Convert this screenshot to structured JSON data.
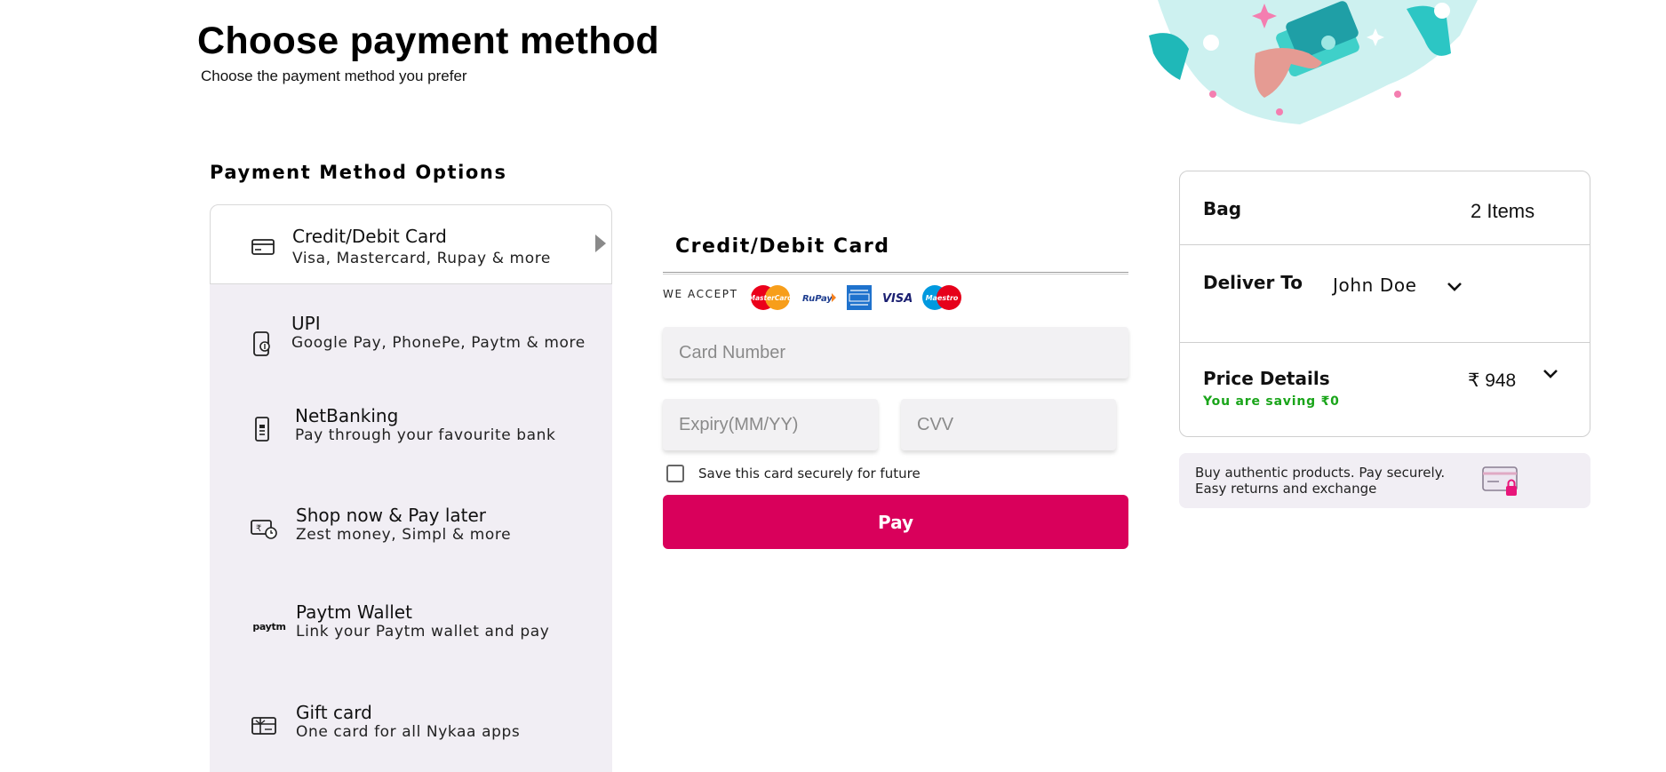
{
  "header": {
    "title": "Choose payment method",
    "subtitle": "Choose the payment method you prefer"
  },
  "options": {
    "title": "Payment Method Options",
    "items": [
      {
        "title": "Credit/Debit Card",
        "subtitle": "Visa, Mastercard, Rupay & more",
        "icon": "credit-card-icon"
      },
      {
        "title": "UPI",
        "subtitle": "Google Pay, PhonePe, Paytm & more",
        "icon": "upi-phone-icon"
      },
      {
        "title": "NetBanking",
        "subtitle": "Pay through your favourite bank",
        "icon": "bank-mobile-icon"
      },
      {
        "title": "Shop now & Pay later",
        "subtitle": "Zest money, Simpl & more",
        "icon": "rupee-clock-icon"
      },
      {
        "title": "Paytm Wallet",
        "subtitle": "Link your Paytm wallet and pay",
        "icon": "paytm-icon"
      },
      {
        "title": "Gift card",
        "subtitle": "One card for all Nykaa apps",
        "icon": "gift-card-icon"
      }
    ],
    "paytm_mark": "paytm"
  },
  "card_form": {
    "heading": "Credit/Debit Card",
    "we_accept": "WE ACCEPT",
    "logos": {
      "mastercard": "MasterCard",
      "rupay": "RuPay",
      "visa": "VISA",
      "maestro": "Maestro"
    },
    "card_number_placeholder": "Card Number",
    "expiry_placeholder": "Expiry(MM/YY)",
    "cvv_placeholder": "CVV",
    "save_label": "Save this card securely for future",
    "pay_label": "Pay"
  },
  "summary": {
    "bag_label": "Bag",
    "bag_value": "2 Items",
    "deliver_label": "Deliver To",
    "deliver_value": "John Doe",
    "price_label": "Price Details",
    "price_value": "₹ 948",
    "saving_text": "You are saving ₹0"
  },
  "trust": {
    "text": "Buy authentic products. Pay securely. Easy returns and exchange"
  },
  "colors": {
    "accent": "#d9005b",
    "panel": "#f1eef4",
    "saving": "#1aa51a"
  }
}
